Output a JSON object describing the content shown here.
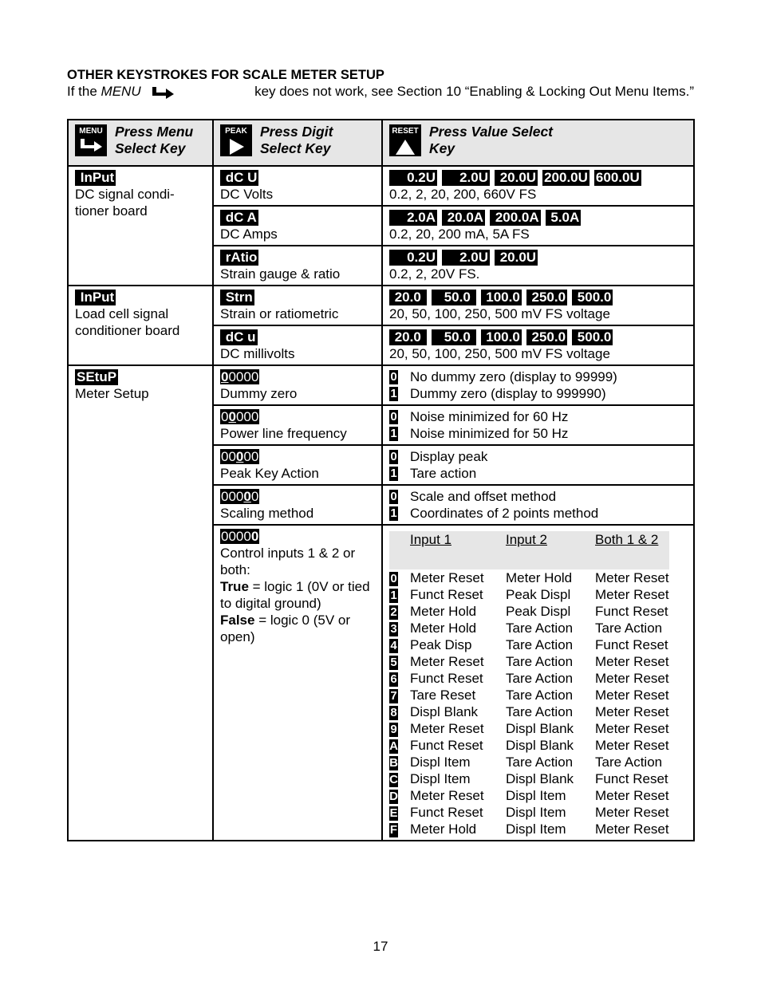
{
  "heading": "OTHER KEYSTROKES FOR SCALE METER SETUP",
  "intro": {
    "prefix": "If the",
    "menu_word": "MENU",
    "arrow_icon": "menu-arrow-icon",
    "suffix": "key does not work, see Section 10 “Enabling & Locking Out Menu Items.”"
  },
  "header": {
    "col1": {
      "key_label": "MENU",
      "icon": "menu-arrow-icon",
      "line1": "Press Menu",
      "line2": "Select Key"
    },
    "col2": {
      "key_label": "PEAK",
      "icon": "right-triangle-icon",
      "line1": "Press Digit",
      "line2": "Select Key"
    },
    "col3": {
      "key_label": "RESET",
      "icon": "up-triangle-icon",
      "line1": "Press Value Select",
      "line2": "Key"
    }
  },
  "groups": {
    "dc_input": {
      "code": " InPut",
      "desc": "DC signal condi-tioner board",
      "rows": [
        {
          "code": " dC U",
          "desc": "DC Volts",
          "values": [
            "  0.2U",
            "  2.0U",
            " 20.0U",
            "200.0U",
            "600.0U"
          ],
          "note": "0.2, 2, 20, 200, 660V FS"
        },
        {
          "code": " dC A",
          "desc": "DC Amps",
          "values": [
            "  2.0A",
            " 20.0A",
            " 200.0A",
            " 5.0A"
          ],
          "note": "0.2, 20, 200 mA, 5A FS"
        },
        {
          "code": " rAtio",
          "desc": "Strain gauge & ratio",
          "values": [
            "  0.2U",
            "  2.0U",
            " 20.0U"
          ],
          "note": "0.2, 2, 20V FS."
        }
      ]
    },
    "load_input": {
      "code": " InPut",
      "desc": "Load cell signal conditioner board",
      "rows": [
        {
          "code": " Strn",
          "desc": "Strain or ratiometric",
          "values": [
            " 20.0 ",
            "   50.0 ",
            " 100.0",
            " 250.0",
            " 500.0"
          ],
          "note": "20, 50, 100, 250, 500 mV FS voltage"
        },
        {
          "code": " dC u",
          "desc": "DC millivolts",
          "values": [
            " 20.0 ",
            "   50.0 ",
            " 100.0",
            " 250.0",
            " 500.0"
          ],
          "note": "20, 50, 100, 250, 500 mV FS voltage"
        }
      ]
    },
    "setup": {
      "code": "SEtuP",
      "desc": "Meter Setup",
      "rows": [
        {
          "code_pre": "",
          "code_sel": "0",
          "code_post": "0000",
          "desc": "Dummy zero",
          "opt0": "No dummy zero (display to 99999)",
          "opt1": "Dummy zero (display to 999990)"
        },
        {
          "code_pre": "0",
          "code_sel": "0",
          "code_post": "000",
          "desc": "Power line frequency",
          "opt0": "Noise minimized for 60 Hz",
          "opt1": "Noise minimized for 50 Hz"
        },
        {
          "code_pre": "00",
          "code_sel": "0",
          "code_post": "00",
          "desc": "Peak Key Action",
          "opt0": "Display peak",
          "opt1": "Tare action"
        },
        {
          "code_pre": "000",
          "code_sel": "0",
          "code_post": "0",
          "desc": "Scaling method",
          "opt0": "Scale and offset method",
          "opt1": "Coordinates of 2 points method"
        }
      ],
      "control": {
        "code_pre": "0000",
        "code_sel": "0",
        "desc1": "Control inputs 1 & 2 or both:",
        "true_label": "True",
        "true_text": " = logic 1 (0V or tied to digital ground)",
        "false_label": "False",
        "false_text": " = logic 0 (5V or open)",
        "headers": [
          "Input 1",
          "Input 2",
          "Both 1 & 2"
        ],
        "rows": [
          {
            "key": "0",
            "in1": "Meter Reset",
            "in2": "Meter Hold",
            "both": "Meter Reset"
          },
          {
            "key": "1",
            "in1": "Funct Reset",
            "in2": "Peak Displ",
            "both": "Meter Reset"
          },
          {
            "key": "2",
            "in1": "Meter Hold",
            "in2": "Peak Displ",
            "both": "Funct Reset"
          },
          {
            "key": "3",
            "in1": "Meter Hold",
            "in2": "Tare Action",
            "both": "Tare Action"
          },
          {
            "key": "4",
            "in1": "Peak Disp",
            "in2": "Tare Action",
            "both": "Funct Reset"
          },
          {
            "key": "5",
            "in1": "Meter Reset",
            "in2": "Tare Action",
            "both": "Meter Reset"
          },
          {
            "key": "6",
            "in1": "Funct Reset",
            "in2": "Tare Action",
            "both": "Meter Reset"
          },
          {
            "key": "7",
            "in1": "Tare Reset",
            "in2": "Tare Action",
            "both": "Meter Reset"
          },
          {
            "key": "8",
            "in1": "Displ Blank",
            "in2": "Tare Action",
            "both": "Meter Reset"
          },
          {
            "key": "9",
            "in1": "Meter Reset",
            "in2": "Displ Blank",
            "both": "Meter Reset"
          },
          {
            "key": "A",
            "in1": "Funct Reset",
            "in2": "Displ Blank",
            "both": "Meter Reset"
          },
          {
            "key": "B",
            "in1": "Displ Item",
            "in2": "Tare Action",
            "both": "Tare Action"
          },
          {
            "key": "C",
            "in1": "Displ Item",
            "in2": "Displ Blank",
            "both": "Funct Reset"
          },
          {
            "key": "D",
            "in1": "Meter Reset",
            "in2": "Displ Item",
            "both": "Meter Reset"
          },
          {
            "key": "E",
            "in1": "Funct Reset",
            "in2": "Displ Item",
            "both": "Meter Reset"
          },
          {
            "key": "F",
            "in1": "Meter Hold",
            "in2": "Displ Item",
            "both": "Meter Reset"
          }
        ]
      }
    }
  },
  "page_number": "17"
}
